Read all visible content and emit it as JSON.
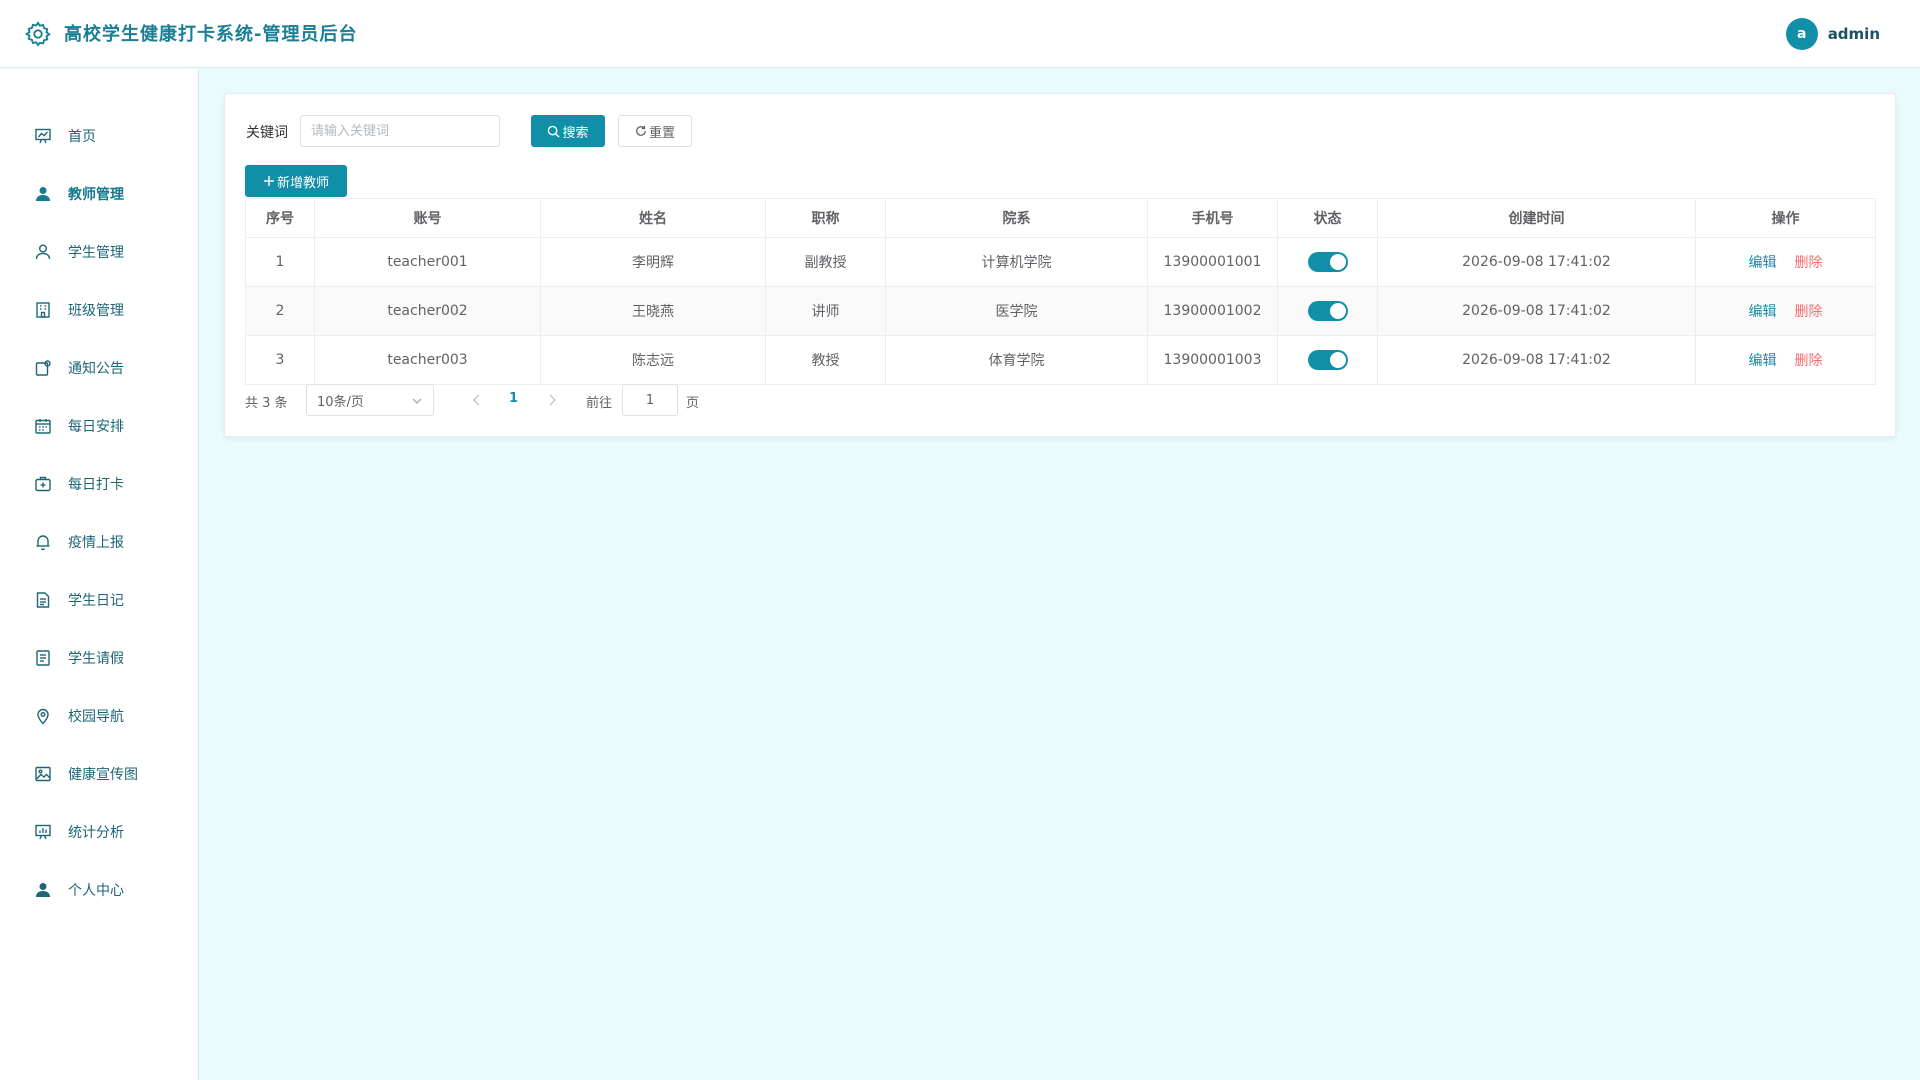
{
  "header": {
    "title": "高校学生健康打卡系统-管理员后台",
    "avatar_letter": "a",
    "username": "admin"
  },
  "sidebar": {
    "items": [
      {
        "label": "首页",
        "icon": "chart-board-icon"
      },
      {
        "label": "教师管理",
        "icon": "user-filled-icon",
        "active": true
      },
      {
        "label": "学生管理",
        "icon": "user-outline-icon"
      },
      {
        "label": "班级管理",
        "icon": "building-icon"
      },
      {
        "label": "通知公告",
        "icon": "notice-icon"
      },
      {
        "label": "每日安排",
        "icon": "calendar-icon"
      },
      {
        "label": "每日打卡",
        "icon": "first-aid-icon"
      },
      {
        "label": "疫情上报",
        "icon": "bell-icon"
      },
      {
        "label": "学生日记",
        "icon": "document-icon"
      },
      {
        "label": "学生请假",
        "icon": "tickets-icon"
      },
      {
        "label": "校园导航",
        "icon": "location-icon"
      },
      {
        "label": "健康宣传图",
        "icon": "picture-icon"
      },
      {
        "label": "统计分析",
        "icon": "data-board-icon"
      },
      {
        "label": "个人中心",
        "icon": "user-filled-icon"
      }
    ]
  },
  "search": {
    "label": "关键词",
    "placeholder": "请输入关键词",
    "search_label": "搜索",
    "reset_label": "重置",
    "add_label": "新增教师"
  },
  "table": {
    "columns": [
      "序号",
      "账号",
      "姓名",
      "职称",
      "院系",
      "手机号",
      "状态",
      "创建时间",
      "操作"
    ],
    "rows": [
      {
        "index": "1",
        "account": "teacher001",
        "name": "李明辉",
        "title": "副教授",
        "dept": "计算机学院",
        "phone": "13900001001",
        "status_on": true,
        "created": "2026-09-08 17:41:02"
      },
      {
        "index": "2",
        "account": "teacher002",
        "name": "王晓燕",
        "title": "讲师",
        "dept": "医学院",
        "phone": "13900001002",
        "status_on": true,
        "created": "2026-09-08 17:41:02"
      },
      {
        "index": "3",
        "account": "teacher003",
        "name": "陈志远",
        "title": "教授",
        "dept": "体育学院",
        "phone": "13900001003",
        "status_on": true,
        "created": "2026-09-08 17:41:02"
      }
    ],
    "edit_label": "编辑",
    "delete_label": "删除"
  },
  "pagination": {
    "total_text": "共 3 条",
    "page_size": "10条/页",
    "current_page": "1",
    "goto_label": "前往",
    "goto_value": "1",
    "page_suffix": "页"
  },
  "colors": {
    "primary": "#128fa8",
    "danger": "#f56c6c",
    "background": "#eafbfd"
  }
}
